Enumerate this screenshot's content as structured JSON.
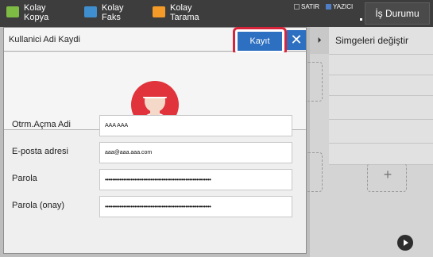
{
  "topbar": {
    "shortcuts": [
      {
        "label": "Kolay Kopya",
        "icon": "copy-icon",
        "color": "#7dbb44"
      },
      {
        "label": "Kolay Faks",
        "icon": "fax-icon",
        "color": "#3f8fd0"
      },
      {
        "label": "Kolay Tarama",
        "icon": "scan-icon",
        "color": "#f39a28"
      }
    ],
    "status_line": "SATIR",
    "status_printer": "YAZICI",
    "job_status_label": "İş Durumu"
  },
  "dialog": {
    "title": "Kullanici Adi Kaydi",
    "save_label": "Kayıt",
    "close_glyph": "✕",
    "fields": [
      {
        "label": "Otrm.Açma Adi",
        "value": "AAA AAA"
      },
      {
        "label": "E-posta adresi",
        "value": "aaa@aaa.aaa.com"
      },
      {
        "label": "Parola",
        "value": "••••••••••••••••••••••••••••••••••••••••••••••••••••••••••"
      },
      {
        "label": "Parola (onay)",
        "value": "••••••••••••••••••••••••••••••••••••••••••••••••••••••••••"
      }
    ]
  },
  "home": {
    "menu_title": "Simgeleri değiştir",
    "tab_glyph": "⏵",
    "add_glyph": "+"
  },
  "colors": {
    "accent": "#2d6fc0",
    "highlight": "#d8243a",
    "topbar": "#3d3d3d",
    "avatar": "#e0333b"
  }
}
